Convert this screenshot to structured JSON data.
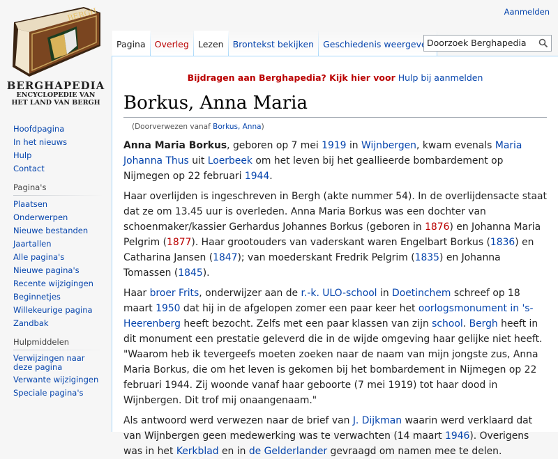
{
  "logo": {
    "book_label": "BERGH",
    "title": "BERGHAPEDIA",
    "subtitle_line1": "ENCYCLOPEDIE VAN",
    "subtitle_line2": "HET LAND VAN BERGH"
  },
  "personal": {
    "login": "Aanmelden"
  },
  "tabs": {
    "page": "Pagina",
    "talk": "Overleg",
    "read": "Lezen",
    "view_source": "Brontekst bekijken",
    "history": "Geschiedenis weergeven"
  },
  "search": {
    "placeholder": "Doorzoek Berghapedia"
  },
  "sidebar": {
    "nav": [
      {
        "label": "Hoofdpagina"
      },
      {
        "label": "In het nieuws"
      },
      {
        "label": "Hulp"
      },
      {
        "label": "Contact"
      }
    ],
    "pages_heading": "Pagina's",
    "pages": [
      {
        "label": "Plaatsen"
      },
      {
        "label": "Onderwerpen"
      },
      {
        "label": "Nieuwe bestanden"
      },
      {
        "label": "Jaartallen"
      },
      {
        "label": "Alle pagina's"
      },
      {
        "label": "Nieuwe pagina's"
      },
      {
        "label": "Recente wijzigingen"
      },
      {
        "label": "Beginnetjes"
      },
      {
        "label": "Willekeurige pagina"
      },
      {
        "label": "Zandbak"
      }
    ],
    "tools_heading": "Hulpmiddelen",
    "tools": [
      {
        "label": "Verwijzingen naar deze pagina"
      },
      {
        "label": "Verwante wijzigingen"
      },
      {
        "label": "Speciale pagina's"
      }
    ]
  },
  "sitenotice": {
    "bold": "Bijdragen aan Berghapedia? Kijk hier voor",
    "link": "Hulp bij aanmelden"
  },
  "article": {
    "title": "Borkus, Anna Maria",
    "redirect_prefix": "(Doorverwezen vanaf ",
    "redirect_link": "Borkus, Anna",
    "redirect_suffix": ")",
    "p1": {
      "bold": "Anna Maria Borkus",
      "t1": ", geboren op 7 mei ",
      "l1": "1919",
      "t2": " in ",
      "l2": "Wijnbergen",
      "t3": ", kwam evenals ",
      "l3": "Maria Johanna Thus",
      "t4": " uit ",
      "l4": "Loerbeek",
      "t5": " om het leven bij het geallieerde bombardement op Nijmegen op 22 februari ",
      "l5": "1944",
      "t6": "."
    },
    "p2": {
      "t1": "Haar overlijden is ingeschreven in Bergh (akte nummer 54). In de overlijdensacte staat dat ze om 13.45 uur is overleden. Anna Maria Borkus was een dochter van schoenmaker/kassier Gerhardus Johannes Borkus (geboren in ",
      "l1": "1876",
      "t2": ") en Johanna Maria Pelgrim (",
      "l2": "1877",
      "t3": "). Haar grootouders van vaderskant waren Engelbart Borkus (",
      "l3": "1836",
      "t4": ") en Catharina Jansen (",
      "l4": "1847",
      "t5": "); van moederskant Fredrik Pelgrim (",
      "l5": "1835",
      "t6": ") en Johanna Tomassen (",
      "l6": "1845",
      "t7": ")."
    },
    "p3": {
      "t1": "Haar ",
      "l1": "broer Frits",
      "t2": ", onderwijzer aan de ",
      "l2": "r.-k. ULO-school",
      "t3": " in ",
      "l3": "Doetinchem",
      "t4": " schreef op 18 maart ",
      "l4": "1950",
      "t5": " dat hij in de afgelopen zomer een paar keer het ",
      "l5": "oorlogsmonument in 's-Heerenberg",
      "t6": " heeft bezocht. Zelfs met een paar klassen van zijn ",
      "l6": "school",
      "t7": ". ",
      "l7": "Bergh",
      "t8": " heeft in dit monument een prestatie geleverd die in de wijde omgeving haar gelijke niet heeft. \"Waarom heb ik tevergeefs moeten zoeken naar de naam van mijn jongste zus, Anna Maria Borkus, die om het leven is gekomen bij het bombardement in Nijmegen op 22 februari 1944. Zij woonde vanaf haar geboorte (7 mei 1919) tot haar dood in Wijnbergen. Dit trof mij onaangenaam.\""
    },
    "p4": {
      "t1": "Als antwoord werd verwezen naar de brief van ",
      "l1": "J. Dijkman",
      "t2": " waarin werd verklaard dat van Wijnbergen geen medewerking was te verwachten (14 maart ",
      "l2": "1946",
      "t3": "). Overigens was in het ",
      "l3": "Kerkblad",
      "t4": " en in ",
      "l4": "de Gelderlander",
      "t5": " gevraagd om namen mee te delen."
    }
  },
  "colors": {
    "link": "#0645ad",
    "new_link": "#ba0000",
    "border": "#a7d7f9",
    "sidebar_bg": "#f6f6f6"
  }
}
